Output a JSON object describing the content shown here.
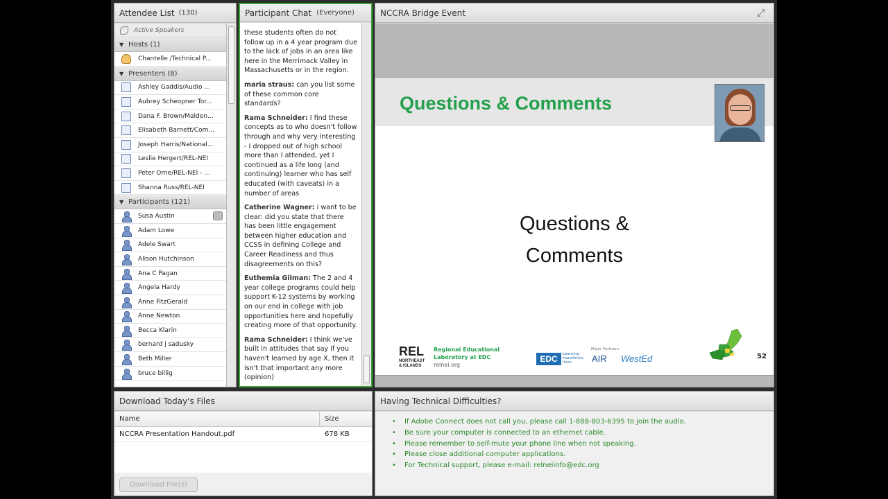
{
  "attendee": {
    "title": "Attendee List",
    "count": "(130)",
    "active_speakers": "Active Speakers",
    "hosts": {
      "label": "Hosts (1)",
      "items": [
        "Chantelle /Technical P..."
      ]
    },
    "presenters": {
      "label": "Presenters (8)",
      "items": [
        "Ashley Gaddis/Audio ...",
        "Aubrey Scheopner Tor...",
        "Dana F. Brown/Malden...",
        "Elisabeth Barnett/Com...",
        "Joseph Harris/National...",
        "Leslie Hergert/REL-NEI",
        "Peter Orne/REL-NEI - ...",
        "Shanna Russ/REL-NEI"
      ]
    },
    "participants": {
      "label": "Participants (121)",
      "items": [
        "Susa Austin",
        "Adam Lowe",
        "Adele Swart",
        "Alison Hutchinson",
        "Ana C Pagan",
        "Angela Hardy",
        "Anne FitzGerald",
        "Anne Newton",
        "Becca Klarin",
        "bernard j sadusky",
        "Beth Miller",
        "bruce billig"
      ]
    }
  },
  "chat": {
    "title": "Participant Chat",
    "scope": "(Everyone)",
    "messages": [
      {
        "author": "",
        "text": "these students often do not follow up in a 4 year program due to the lack of jobs in an area like here in the Merrimack Valley in Massachusetts or in the region."
      },
      {
        "author": "maria straus:",
        "text": " can you list some of these common core standards?"
      },
      {
        "author": "Rama Schneider:",
        "text": " I find these concepts as to who doesn't follow through and why very interesting - I dropped out of high school more than I attended, yet I continued as a life long (and continuing) learner who has self educated (with caveats) in a number of areas"
      },
      {
        "author": "Catherine Wagner:",
        "text": " i want to be clear: did you state that there has been little engagement between higher education and CCSS in defining College and Career Readiness and thus disagreements on this?"
      },
      {
        "author": "Euthemia Gilman:",
        "text": " The 2 and 4 year college programs could help support K-12 systems by working on our end in college with job opportunities here and hopefully creating more of that opportunity."
      },
      {
        "author": "Rama Schneider:",
        "text": " I think we've built in attitudes that say if you haven't learned by age X, then it isn't that important any more (opinion)"
      }
    ]
  },
  "share": {
    "title": "NCCRA Bridge Event",
    "slide": {
      "heading": "Questions & Comments",
      "body_line1": "Questions &",
      "body_line2": "Comments",
      "rel_logo": "REL",
      "rel_logo_sub1": "NORTHEAST",
      "rel_logo_sub2": "& ISLANDS",
      "rel_line1": "Regional Educational",
      "rel_line2": "Laboratory at EDC",
      "rel_url": "relnei.org",
      "edc": "EDC",
      "edc_tag1": "Learning",
      "edc_tag2": "transforms",
      "edc_tag3": "lives.",
      "partners_label": "Major Partners:",
      "air": "AIR",
      "wested": "WestEd",
      "page_number": "52"
    }
  },
  "files": {
    "title": "Download Today's Files",
    "col_name": "Name",
    "col_size": "Size",
    "rows": [
      {
        "name": "NCCRA Presentation Handout.pdf",
        "size": "678 KB"
      }
    ],
    "button": "Download File(s)"
  },
  "tech": {
    "title": "Having Technical Difficulties?",
    "items": [
      "If Adobe Connect does not call you, please call 1-888-803-6395 to join the audio.",
      "Be sure your computer is connected to an ethernet cable.",
      "Please remember to self-mute your phone line when not speaking.",
      "Please close additional computer applications.",
      "For Technical support, please e-mail: relneiinfo@edc.org"
    ]
  },
  "colors": {
    "accent_green": "#23a04c",
    "chat_border": "#3da43b",
    "tech_text": "#2c8a2c"
  }
}
